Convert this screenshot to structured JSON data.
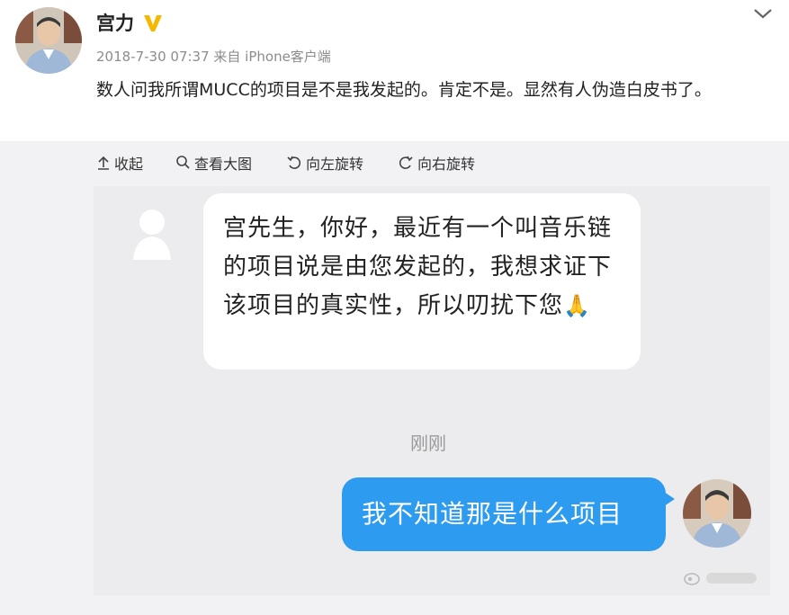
{
  "post": {
    "author": "宫力",
    "timestamp": "2018-7-30 07:37",
    "source": "来自 iPhone客户端",
    "text": "数人问我所谓MUCC的项目是不是我发起的。肯定不是。显然有人伪造白皮书了。"
  },
  "toolbar": {
    "collapse_label": "收起",
    "view_large_label": "查看大图",
    "rotate_left_label": "向左旋转",
    "rotate_right_label": "向右旋转"
  },
  "chat": {
    "incoming_message": "宫先生，你好，最近有一个叫音乐链的项目说是由您发起的，我想求证下该项目的真实性，所以叨扰下您",
    "incoming_emoji": "🙏",
    "time_label": "刚刚",
    "outgoing_message": "我不知道那是什么项目"
  },
  "icons": {
    "verified": "verified-v-icon",
    "chevron": "chevron-down-icon",
    "collapse": "arrow-up-icon",
    "zoom": "magnifier-icon",
    "rotate_left": "rotate-left-icon",
    "rotate_right": "rotate-right-icon",
    "watermark": "weibo-watermark-icon"
  },
  "colors": {
    "verified_badge": "#f5b800",
    "outgoing_bubble": "#2d9bf0",
    "page_background": "#f2f2f5"
  }
}
